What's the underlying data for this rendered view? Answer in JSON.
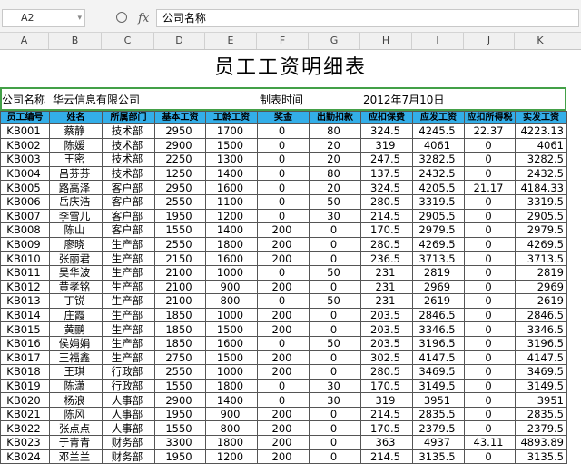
{
  "toolbar": {
    "cell_ref": "A2",
    "fx_label": "fx",
    "formula_value": "公司名称"
  },
  "columns": [
    "A",
    "B",
    "C",
    "D",
    "E",
    "F",
    "G",
    "H",
    "I",
    "J",
    "K"
  ],
  "sheet": {
    "title": "员工工资明细表",
    "company_label": "公司名称",
    "company_name": "华云信息有限公司",
    "time_label": "制表时间",
    "time_value": "2012年7月10日",
    "headers": [
      "员工编号",
      "姓名",
      "所属部门",
      "基本工资",
      "工龄工资",
      "奖金",
      "出勤扣款",
      "应扣保费",
      "应发工资",
      "应扣所得税",
      "实发工资"
    ],
    "rows": [
      [
        "KB001",
        "蔡静",
        "技术部",
        "2950",
        "1700",
        "0",
        "80",
        "324.5",
        "4245.5",
        "22.37",
        "4223.13"
      ],
      [
        "KB002",
        "陈媛",
        "技术部",
        "2900",
        "1500",
        "0",
        "20",
        "319",
        "4061",
        "0",
        "4061"
      ],
      [
        "KB003",
        "王密",
        "技术部",
        "2250",
        "1300",
        "0",
        "20",
        "247.5",
        "3282.5",
        "0",
        "3282.5"
      ],
      [
        "KB004",
        "吕芬芬",
        "技术部",
        "1250",
        "1400",
        "0",
        "80",
        "137.5",
        "2432.5",
        "0",
        "2432.5"
      ],
      [
        "KB005",
        "路高泽",
        "客户部",
        "2950",
        "1600",
        "0",
        "20",
        "324.5",
        "4205.5",
        "21.17",
        "4184.33"
      ],
      [
        "KB006",
        "岳庆浩",
        "客户部",
        "2550",
        "1100",
        "0",
        "50",
        "280.5",
        "3319.5",
        "0",
        "3319.5"
      ],
      [
        "KB007",
        "李雪儿",
        "客户部",
        "1950",
        "1200",
        "0",
        "30",
        "214.5",
        "2905.5",
        "0",
        "2905.5"
      ],
      [
        "KB008",
        "陈山",
        "客户部",
        "1550",
        "1400",
        "200",
        "0",
        "170.5",
        "2979.5",
        "0",
        "2979.5"
      ],
      [
        "KB009",
        "廖晓",
        "生产部",
        "2550",
        "1800",
        "200",
        "0",
        "280.5",
        "4269.5",
        "0",
        "4269.5"
      ],
      [
        "KB010",
        "张丽君",
        "生产部",
        "2150",
        "1600",
        "200",
        "0",
        "236.5",
        "3713.5",
        "0",
        "3713.5"
      ],
      [
        "KB011",
        "吴华波",
        "生产部",
        "2100",
        "1000",
        "0",
        "50",
        "231",
        "2819",
        "0",
        "2819"
      ],
      [
        "KB012",
        "黄孝铭",
        "生产部",
        "2100",
        "900",
        "200",
        "0",
        "231",
        "2969",
        "0",
        "2969"
      ],
      [
        "KB013",
        "丁锐",
        "生产部",
        "2100",
        "800",
        "0",
        "50",
        "231",
        "2619",
        "0",
        "2619"
      ],
      [
        "KB014",
        "庄霞",
        "生产部",
        "1850",
        "1000",
        "200",
        "0",
        "203.5",
        "2846.5",
        "0",
        "2846.5"
      ],
      [
        "KB015",
        "黄鹂",
        "生产部",
        "1850",
        "1500",
        "200",
        "0",
        "203.5",
        "3346.5",
        "0",
        "3346.5"
      ],
      [
        "KB016",
        "侯娟娟",
        "生产部",
        "1850",
        "1600",
        "0",
        "50",
        "203.5",
        "3196.5",
        "0",
        "3196.5"
      ],
      [
        "KB017",
        "王福鑫",
        "生产部",
        "2750",
        "1500",
        "200",
        "0",
        "302.5",
        "4147.5",
        "0",
        "4147.5"
      ],
      [
        "KB018",
        "王琪",
        "行政部",
        "2550",
        "1000",
        "200",
        "0",
        "280.5",
        "3469.5",
        "0",
        "3469.5"
      ],
      [
        "KB019",
        "陈潇",
        "行政部",
        "1550",
        "1800",
        "0",
        "30",
        "170.5",
        "3149.5",
        "0",
        "3149.5"
      ],
      [
        "KB020",
        "杨浪",
        "人事部",
        "2900",
        "1400",
        "0",
        "30",
        "319",
        "3951",
        "0",
        "3951"
      ],
      [
        "KB021",
        "陈风",
        "人事部",
        "1950",
        "900",
        "200",
        "0",
        "214.5",
        "2835.5",
        "0",
        "2835.5"
      ],
      [
        "KB022",
        "张点点",
        "人事部",
        "1550",
        "800",
        "200",
        "0",
        "170.5",
        "2379.5",
        "0",
        "2379.5"
      ],
      [
        "KB023",
        "于青青",
        "财务部",
        "3300",
        "1800",
        "200",
        "0",
        "363",
        "4937",
        "43.11",
        "4893.89"
      ],
      [
        "KB024",
        "邓兰兰",
        "财务部",
        "1950",
        "1200",
        "200",
        "0",
        "214.5",
        "3135.5",
        "0",
        "3135.5"
      ]
    ]
  }
}
